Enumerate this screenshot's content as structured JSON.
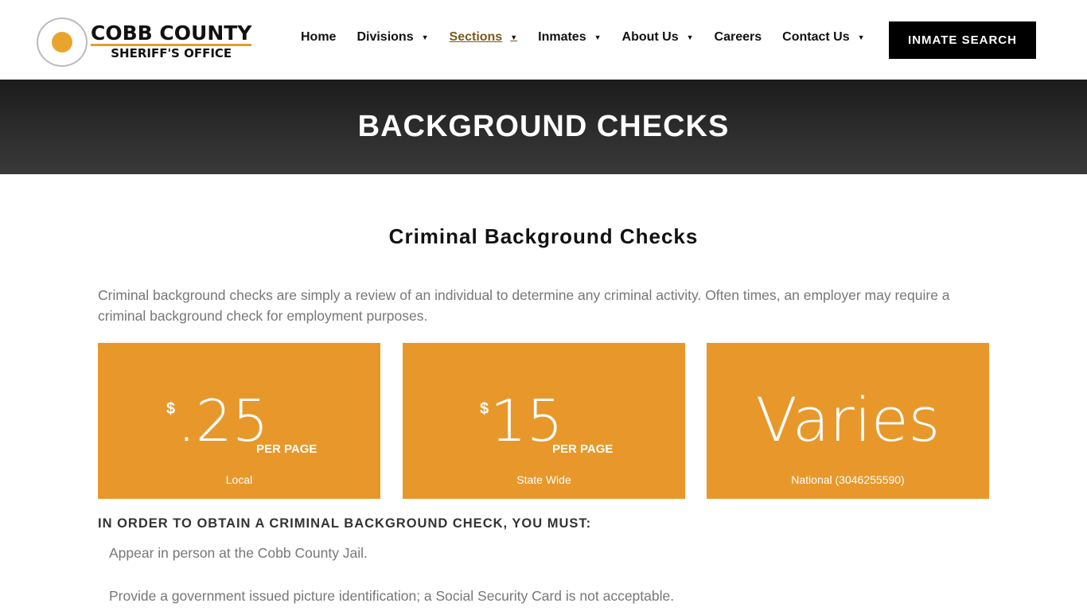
{
  "logo": {
    "title": "COBB COUNTY",
    "subtitle": "SHERIFF'S OFFICE",
    "seal_text": "COBB COUNTY SHERIFF SHERIFF'S OFFICE"
  },
  "nav": {
    "items": [
      {
        "label": "Home",
        "dropdown": false
      },
      {
        "label": "Divisions",
        "dropdown": true
      },
      {
        "label": "Sections",
        "dropdown": true,
        "active": true
      },
      {
        "label": "Inmates",
        "dropdown": true
      },
      {
        "label": "About Us",
        "dropdown": true
      },
      {
        "label": "Careers",
        "dropdown": false
      },
      {
        "label": "Contact Us",
        "dropdown": true
      }
    ],
    "cta": "INMATE SEARCH"
  },
  "banner": {
    "title": "BACKGROUND CHECKS"
  },
  "section": {
    "title": "Criminal Background Checks",
    "intro": "Criminal background checks are simply a review of an individual to determine any criminal activity. Often times, an employer may require a criminal background check for employment purposes."
  },
  "cards": [
    {
      "currency": "$",
      "amount": ".25",
      "unit": "PER PAGE",
      "label": "Local"
    },
    {
      "currency": "$",
      "amount": "15",
      "unit": "PER PAGE",
      "label": "State Wide"
    },
    {
      "amount": "Varies",
      "label": "National (3046255590)"
    }
  ],
  "requirements": {
    "heading": "IN ORDER TO OBTAIN A CRIMINAL BACKGROUND CHECK, YOU MUST:",
    "items": [
      "Appear in person at the Cobb County Jail.",
      "Provide a government issued picture identification; a Social Security Card is not acceptable."
    ]
  },
  "colors": {
    "accent": "#e8982b",
    "banner": "#2a2a2a",
    "active_nav": "#7a5a1e"
  }
}
